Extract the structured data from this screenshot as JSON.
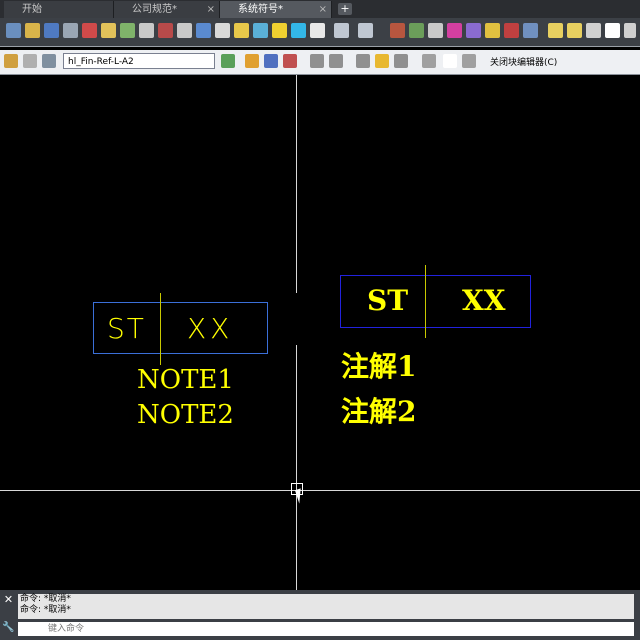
{
  "tabs": [
    {
      "label": "开始"
    },
    {
      "label": "公司规范*"
    },
    {
      "label": "系统符号*"
    }
  ],
  "tab_add_label": "+",
  "block_editor": {
    "block_name": "hl_Fin-Ref-L-A2",
    "close_label": "关闭块编辑器(C)"
  },
  "drawing": {
    "left_block": {
      "left_text": "ST",
      "right_text": "XX",
      "note1": "NOTE1",
      "note2": "NOTE2"
    },
    "right_block": {
      "left_text": "ST",
      "right_text": "XX",
      "note1": "注解1",
      "note2": "注解2"
    }
  },
  "command_line": {
    "history": [
      "命令: *取消*",
      "命令: *取消*"
    ],
    "input_placeholder": "键入命令"
  },
  "colors": {
    "text": "#ffff00",
    "left_box": "#3b6fd8",
    "right_box": "#2222dd",
    "crosshair": "#d8d8d8"
  },
  "icons": {
    "tab_close": "close-icon",
    "cmd_close": "close-icon",
    "cmd_settings": "wrench-icon"
  }
}
